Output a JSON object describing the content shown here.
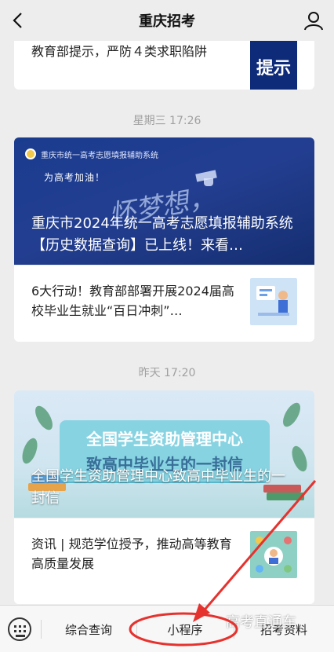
{
  "header": {
    "title": "重庆招考"
  },
  "feed": {
    "card1": {
      "text": "教育部提示，严防４类求职陷阱",
      "thumb_text": "提示"
    },
    "time1": "星期三 17:26",
    "card2": {
      "hero_small": "重庆市统一高考志愿填报辅助系统",
      "hero_cheer": "为高考加油！",
      "hero_dream": "怀梦想，",
      "overlay_title": "重庆市2024年统一高考志愿填报辅助系统【历史数据查询】已上线！来看…",
      "row_text": "6大行动！教育部部署开展2024届高校毕业生就业“百日冲刺”…"
    },
    "time2": "昨天 17:20",
    "card3": {
      "banner_line1": "全国学生资助管理中心",
      "banner_line2": "致高中毕业生的一封信",
      "overlay_title": "全国学生资助管理中心致高中毕业生的一封信",
      "row_text": "资讯 | 规范学位授予，推动高等教育高质量发展"
    }
  },
  "bottom_menu": {
    "items": [
      "综合查询",
      "小程序",
      "招考资料"
    ]
  },
  "watermark": "高考直通车",
  "colors": {
    "annotation": "#e6322e",
    "hero_blue": "#1a3c8f"
  }
}
